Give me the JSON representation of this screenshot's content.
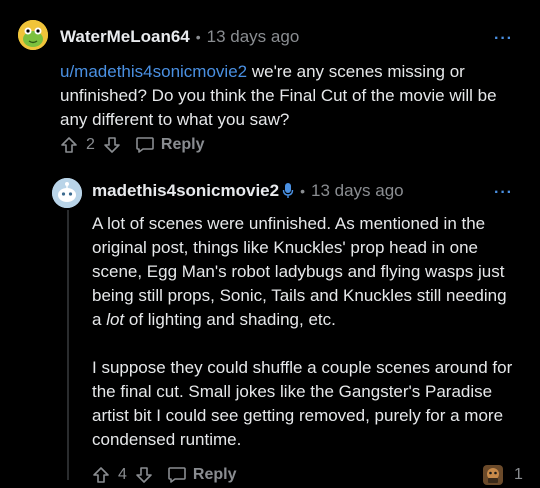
{
  "comment1": {
    "username": "WaterMeLoan64",
    "separator": "•",
    "time": "13 days ago",
    "more": "···",
    "mention": "u/madethis4sonicmovie2",
    "text": " we're any scenes missing or unfinished? Do you think the Final Cut of the movie will be any different to what you saw?",
    "votes": "2",
    "reply_label": "Reply"
  },
  "comment2": {
    "username": "madethis4sonicmovie2",
    "separator": "•",
    "time": "13 days ago",
    "more": "···",
    "para1_a": "A lot of scenes were unfinished. As mentioned in the original post, things like Knuckles' prop head in one scene, Egg Man's robot ladybugs and flying wasps just being still props, Sonic, Tails and Knuckles still needing a ",
    "para1_em": "lot",
    "para1_b": " of lighting and shading, etc.",
    "para2": "I suppose they could shuffle a couple scenes around for the final cut. Small jokes like the Gangster's Paradise artist bit I could see getting removed, purely for a more condensed runtime.",
    "votes": "4",
    "reply_label": "Reply",
    "award_count": "1"
  },
  "colors": {
    "background": "#000000",
    "accent": "#4a90e2",
    "muted": "#8a8d91",
    "text": "#e6e8ea"
  },
  "icons": {
    "op_avatar": "snoo-frog-avatar-icon",
    "op_mic": "microphone-icon",
    "upvote": "upvote-arrow-icon",
    "downvote": "downvote-arrow-icon",
    "reply": "speech-bubble-icon",
    "award": "award-icon"
  }
}
